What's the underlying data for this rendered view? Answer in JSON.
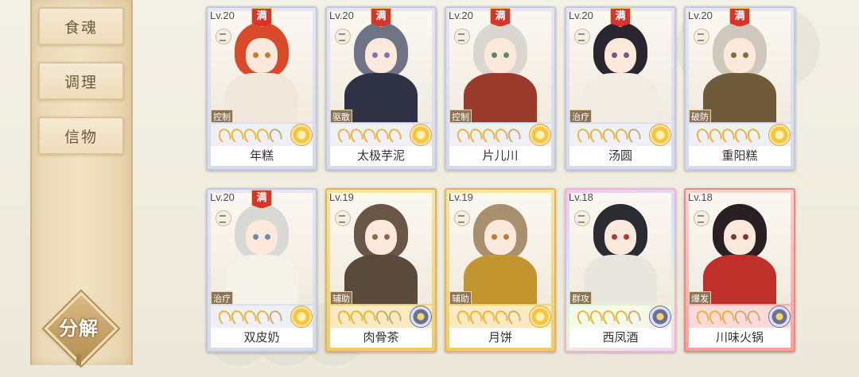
{
  "sidebar": {
    "tabs": [
      {
        "label": "食魂",
        "active": true
      },
      {
        "label": "调理",
        "active": false
      },
      {
        "label": "信物",
        "active": false
      }
    ],
    "decompose_label": "分解"
  },
  "cards": [
    {
      "level": "Lv.20",
      "full": "满",
      "role": "控制",
      "name": "年糕",
      "stars": 4,
      "tier": "a",
      "flower": "gold",
      "hair": "#d84a2a",
      "outfit": "#f2e7dc",
      "eye": "#c77a2a"
    },
    {
      "level": "Lv.20",
      "full": "满",
      "role": "驱散",
      "name": "太极芋泥",
      "stars": 5,
      "tier": "a",
      "flower": "gold",
      "hair": "#6f7386",
      "outfit": "#2e3244",
      "eye": "#8a6ab8"
    },
    {
      "level": "Lv.20",
      "full": "满",
      "role": "控制",
      "name": "片儿川",
      "stars": 4,
      "tier": "a",
      "flower": "gold",
      "hair": "#dad7d1",
      "outfit": "#9a3a2a",
      "eye": "#5a8a6a"
    },
    {
      "level": "Lv.20",
      "full": "满",
      "role": "治疗",
      "name": "汤圆",
      "stars": 4,
      "tier": "a",
      "flower": "gold",
      "hair": "#2a2630",
      "outfit": "#f3ece4",
      "eye": "#6a5a8a"
    },
    {
      "level": "Lv.20",
      "full": "满",
      "role": "破防",
      "name": "重阳糕",
      "stars": 5,
      "tier": "a",
      "flower": "gold",
      "hair": "#cfc9bd",
      "outfit": "#6f5a3a",
      "eye": "#8a6a3a"
    },
    {
      "level": "Lv.20",
      "full": "满",
      "role": "治疗",
      "name": "双皮奶",
      "stars": 4,
      "tier": "a",
      "flower": "gold",
      "hair": "#d8d8d4",
      "outfit": "#f5f2ea",
      "eye": "#6a8aa8"
    },
    {
      "level": "Lv.19",
      "full": "",
      "role": "辅助",
      "name": "肉骨茶",
      "stars": 3,
      "tier": "b",
      "flower": "blue",
      "hair": "#6a5644",
      "outfit": "#5a4a3c",
      "eye": "#8a6a4a"
    },
    {
      "level": "Lv.19",
      "full": "",
      "role": "辅助",
      "name": "月饼",
      "stars": 4,
      "tier": "b",
      "flower": "gold",
      "hair": "#a88f6e",
      "outfit": "#c2952e",
      "eye": "#c07a2a"
    },
    {
      "level": "Lv.18",
      "full": "",
      "role": "群攻",
      "name": "西凤酒",
      "stars": 4,
      "tier": "c",
      "flower": "blue",
      "hair": "#2b2b32",
      "outfit": "#e9e6e0",
      "eye": "#a83a3a"
    },
    {
      "level": "Lv.18",
      "full": "",
      "role": "爆发",
      "name": "川味火锅",
      "stars": 3,
      "tier": "d",
      "flower": "blue",
      "hair": "#2a2024",
      "outfit": "#c0302a",
      "eye": "#7a3a2a"
    }
  ]
}
